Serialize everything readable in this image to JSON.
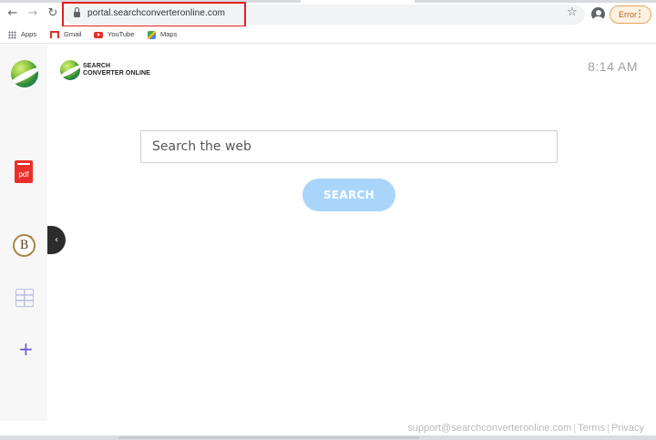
{
  "browser": {
    "url": "portal.searchconverteronline.com",
    "profile_button": "Error",
    "bookmarks": [
      {
        "label": "Apps",
        "icon": "apps-grid-icon"
      },
      {
        "label": "Gmail",
        "icon": "gmail-icon"
      },
      {
        "label": "YouTube",
        "icon": "youtube-icon"
      },
      {
        "label": "Maps",
        "icon": "maps-icon"
      }
    ]
  },
  "sidebar": {
    "pdf_label": "pdf",
    "coin_label": "B",
    "add_label": "+"
  },
  "brand": {
    "line1": "SEARCH",
    "line2": "CONVERTER ONLINE"
  },
  "clock": "8:14 AM",
  "search": {
    "placeholder": "Search the web",
    "button_label": "SEARCH"
  },
  "footer": {
    "email": "support@searchconverteronline.com",
    "terms": "Terms",
    "privacy": "Privacy"
  },
  "colors": {
    "accent": "#a9d5fb",
    "highlight": "#e02020",
    "sidebar_bg": "#f7f7f8"
  }
}
